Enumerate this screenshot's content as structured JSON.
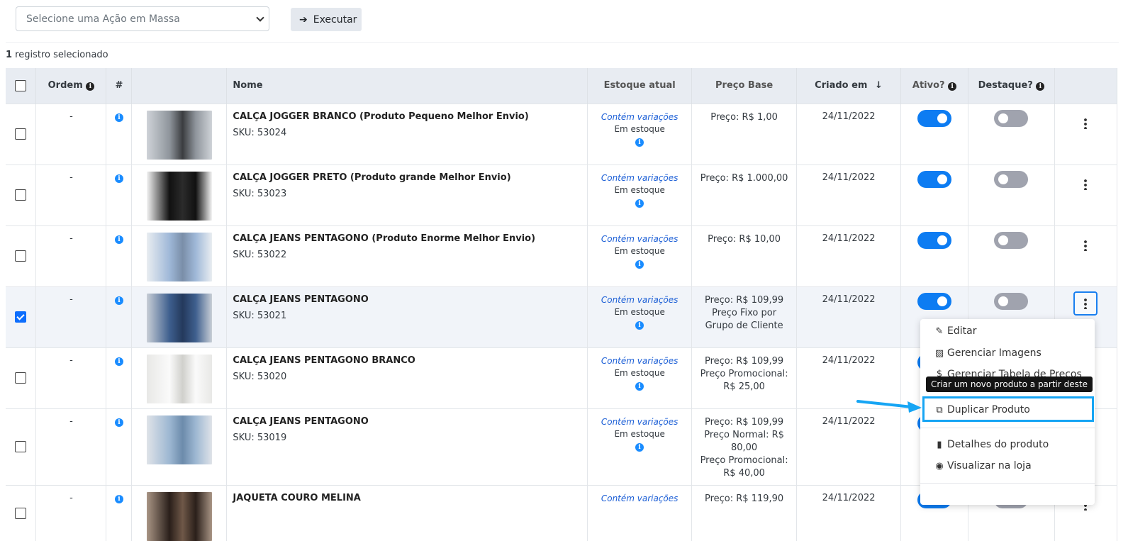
{
  "toolbar": {
    "bulk_placeholder": "Selecione uma Ação em Massa",
    "execute_label": "Executar"
  },
  "selection": {
    "count": "1",
    "text": " registro selecionado"
  },
  "table": {
    "headers": {
      "order": "Ordem",
      "num": "#",
      "name": "Nome",
      "stock": "Estoque atual",
      "price": "Preço Base",
      "created": "Criado em",
      "active": "Ativo?",
      "featured": "Destaque?"
    },
    "rows": [
      {
        "name": "CALÇA JOGGER BRANCO (Produto Pequeno Melhor Envio)",
        "sku": "SKU: 53024",
        "order": "-",
        "stock_var": "Contém variações",
        "stock_status": "Em estoque",
        "price": [
          "Preço: R$ 1,00"
        ],
        "created": "24/11/2022",
        "checked": false,
        "active": true,
        "featured": false
      },
      {
        "name": "CALÇA JOGGER PRETO (Produto grande Melhor Envio)",
        "sku": "SKU: 53023",
        "order": "-",
        "stock_var": "Contém variações",
        "stock_status": "Em estoque",
        "price": [
          "Preço: R$ 1.000,00"
        ],
        "created": "24/11/2022",
        "checked": false,
        "active": true,
        "featured": false
      },
      {
        "name": "CALÇA JEANS PENTAGONO (Produto Enorme Melhor Envio)",
        "sku": "SKU: 53022",
        "order": "-",
        "stock_var": "Contém variações",
        "stock_status": "Em estoque",
        "price": [
          "Preço: R$ 10,00"
        ],
        "created": "24/11/2022",
        "checked": false,
        "active": true,
        "featured": false
      },
      {
        "name": "CALÇA JEANS PENTAGONO",
        "sku": "SKU: 53021",
        "order": "-",
        "stock_var": "Contém variações",
        "stock_status": "Em estoque",
        "price": [
          "Preço: R$ 109,99",
          "Preço Fixo por",
          "Grupo de Cliente"
        ],
        "created": "24/11/2022",
        "checked": true,
        "active": true,
        "featured": false
      },
      {
        "name": "CALÇA JEANS PENTAGONO BRANCO",
        "sku": "SKU: 53020",
        "order": "-",
        "stock_var": "Contém variações",
        "stock_status": "Em estoque",
        "price": [
          "Preço: R$ 109,99",
          "Preço Promocional:",
          "R$ 25,00"
        ],
        "created": "24/11/2022",
        "checked": false,
        "active": true,
        "featured": false
      },
      {
        "name": "CALÇA JEANS PENTAGONO",
        "sku": "SKU: 53019",
        "order": "-",
        "stock_var": "Contém variações",
        "stock_status": "Em estoque",
        "price": [
          "Preço: R$ 109,99",
          "Preço Normal: R$",
          "80,00",
          "Preço Promocional:",
          "R$ 40,00"
        ],
        "created": "24/11/2022",
        "checked": false,
        "active": true,
        "featured": false
      },
      {
        "name": "JAQUETA COURO MELINA",
        "sku": "",
        "order": "-",
        "stock_var": "Contém variações",
        "stock_status": "",
        "price": [
          "Preço: R$ 119,90"
        ],
        "created": "24/11/2022",
        "checked": false,
        "active": true,
        "featured": false
      }
    ]
  },
  "context_menu": {
    "items": [
      "Editar",
      "Gerenciar Imagens",
      "Gerenciar Tabela de Preços",
      "Duplicar Produto",
      "Detalhes do produto",
      "Visualizar na loja"
    ],
    "tooltip": "Criar um novo produto a partir deste"
  },
  "colors": {
    "accent": "#0d7cf2",
    "highlight": "#16a5f4",
    "link": "#1c5fd6"
  }
}
